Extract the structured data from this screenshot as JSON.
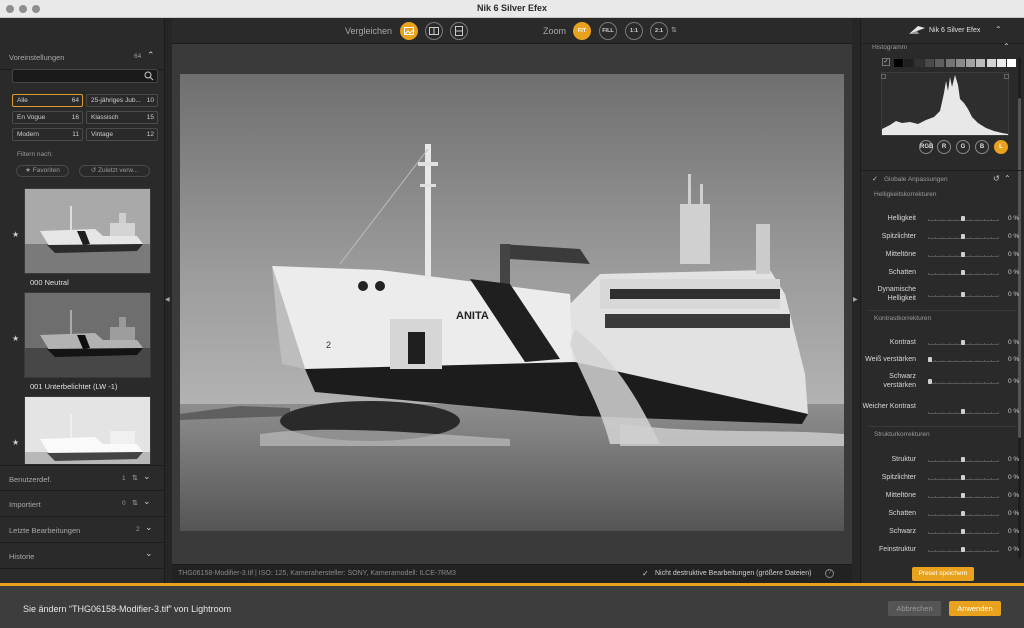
{
  "window": {
    "title": "Nik 6 Silver Efex"
  },
  "left": {
    "presets_header": {
      "label": "Voreinstellungen",
      "count": "64"
    },
    "search": {
      "placeholder": ""
    },
    "categories": [
      {
        "name": "Alle",
        "count": "64"
      },
      {
        "name": "25-jähriges Jub...",
        "count": "10"
      },
      {
        "name": "En Vogue",
        "count": "16"
      },
      {
        "name": "Klassisch",
        "count": "15"
      },
      {
        "name": "Modern",
        "count": "11"
      },
      {
        "name": "Vintage",
        "count": "12"
      }
    ],
    "filter_label": "Filtern nach:",
    "filters": [
      "Favoriten",
      "Zuletzt verw..."
    ],
    "presets": [
      "000 Neutral",
      "001 Unterbelichtet (LW -1)"
    ],
    "sections": [
      {
        "label": "Benutzerdef.",
        "count": "1"
      },
      {
        "label": "Importiert",
        "count": "0"
      },
      {
        "label": "Letzte Bearbeitungen",
        "count": "2"
      },
      {
        "label": "Historie",
        "count": ""
      }
    ]
  },
  "topbar": {
    "compare_label": "Vergleichen",
    "zoom_label": "Zoom",
    "zoom_options": [
      "FIT",
      "FILL",
      "1:1",
      "2:1"
    ],
    "zoom_selected": "FIT"
  },
  "photo": {
    "hull_text": "ANITA",
    "bow_mark": "2"
  },
  "status": {
    "meta": "THG06158-Modifier-3.tif   |   ISO: 125, Kamerahersteller: SONY, Kameramodell: ILCE-7RM3",
    "nondestructive": "Nicht destruktive Bearbeitungen (größere Dateien)",
    "help": "?"
  },
  "right": {
    "brand": "Nik 6 Silver Efex",
    "histogram_label": "Histogramm",
    "channels": [
      "RGB",
      "R",
      "G",
      "B",
      "L"
    ],
    "channel_selected": "L",
    "global_label": "Globale Anpassungen",
    "groups": [
      {
        "title": "Helligkeitskorrekturen",
        "sliders": [
          {
            "label": "Helligkeit",
            "value": "0 %",
            "pos": 0.5
          },
          {
            "label": "Spitzlichter",
            "value": "0 %",
            "pos": 0.5
          },
          {
            "label": "Mitteltöne",
            "value": "0 %",
            "pos": 0.5
          },
          {
            "label": "Schatten",
            "value": "0 %",
            "pos": 0.5
          },
          {
            "label": "Dynamische Helligkeit",
            "value": "0 %",
            "pos": 0.5
          }
        ]
      },
      {
        "title": "Kontrastkorrekturen",
        "sliders": [
          {
            "label": "Kontrast",
            "value": "0 %",
            "pos": 0.5
          },
          {
            "label": "Weiß verstärken",
            "value": "0 %",
            "pos": 0.0
          },
          {
            "label": "Schwarz verstärken",
            "value": "0 %",
            "pos": 0.0
          },
          {
            "label": "Weicher Kontrast",
            "value": "0 %",
            "pos": 0.5
          }
        ]
      },
      {
        "title": "Strukturkorrekturen",
        "sliders": [
          {
            "label": "Struktur",
            "value": "0 %",
            "pos": 0.5
          },
          {
            "label": "Spitzlichter",
            "value": "0 %",
            "pos": 0.5
          },
          {
            "label": "Mitteltöne",
            "value": "0 %",
            "pos": 0.5
          },
          {
            "label": "Schatten",
            "value": "0 %",
            "pos": 0.5
          },
          {
            "label": "Schwarz",
            "value": "0 %",
            "pos": 0.5
          },
          {
            "label": "Feinstruktur",
            "value": "0 %",
            "pos": 0.5
          }
        ]
      }
    ],
    "save_preset": "Preset speichern"
  },
  "host": {
    "message": "Sie ändern “THG06158-Modifier-3.tif” von Lightroom",
    "cancel": "Abbrechen",
    "apply": "Anwenden"
  },
  "colors": {
    "accent": "#e8a21d",
    "panel": "#2a2a2a",
    "canvas": "#3a3a3a"
  }
}
